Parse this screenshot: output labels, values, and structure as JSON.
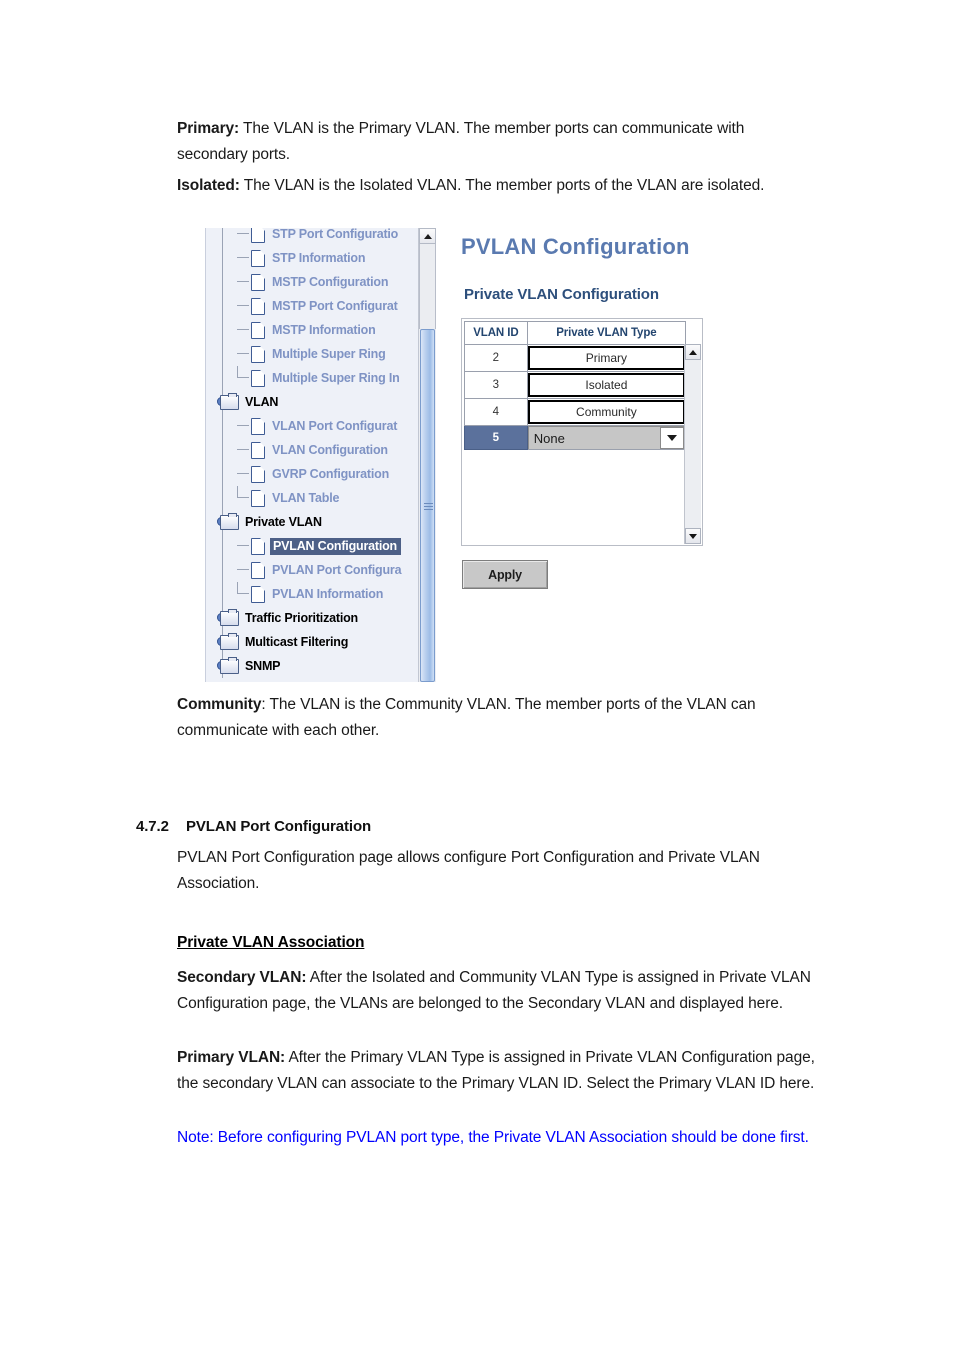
{
  "document": {
    "paragraphs": {
      "primary_label": "Primary:",
      "primary_text": " The VLAN is the Primary VLAN. The member ports can communicate with secondary ports.",
      "isolated_label": "Isolated:",
      "isolated_text": " The VLAN is the Isolated VLAN. The member ports of the VLAN are isolated.",
      "community_label": "Community",
      "community_text": ": The VLAN is the Community VLAN. The member ports of the VLAN can communicate with each other.",
      "section_number": "4.7.2",
      "section_title": "PVLAN Port Configuration",
      "section_body": "PVLAN Port Configuration page allows configure Port Configuration and Private VLAN Association.",
      "subsection_heading": "Private VLAN Association",
      "secondary_label": "Secondary VLAN:",
      "secondary_text": " After the Isolated and Community VLAN Type is assigned in Private VLAN Configuration page, the VLANs are belonged to the Secondary VLAN and displayed here.",
      "primaryvlan_label": "Primary VLAN:",
      "primaryvlan_text": " After the Primary VLAN Type is assigned in Private VLAN Configuration page, the secondary VLAN can associate to the Primary VLAN ID. Select the Primary VLAN ID here.",
      "note_text": "Note: Before configuring PVLAN port type, the Private VLAN Association should be done first."
    },
    "colors": {
      "note_blue": "#0000ff",
      "body_black": "#1a1a1a"
    }
  },
  "screenshot": {
    "title": "PVLAN Configuration",
    "subtitle": "Private VLAN Configuration",
    "title_color": "#5a7ab0",
    "subtitle_color": "#2d4f7c",
    "tree": {
      "items": [
        {
          "label": "STP Port Configuratio",
          "type": "leaf",
          "level": 2,
          "selected": false,
          "last": false
        },
        {
          "label": "STP Information",
          "type": "leaf",
          "level": 2,
          "selected": false,
          "last": false
        },
        {
          "label": "MSTP Configuration",
          "type": "leaf",
          "level": 2,
          "selected": false,
          "last": false
        },
        {
          "label": "MSTP Port Configurat",
          "type": "leaf",
          "level": 2,
          "selected": false,
          "last": false
        },
        {
          "label": "MSTP Information",
          "type": "leaf",
          "level": 2,
          "selected": false,
          "last": false
        },
        {
          "label": "Multiple Super Ring",
          "type": "leaf",
          "level": 2,
          "selected": false,
          "last": false
        },
        {
          "label": "Multiple Super Ring In",
          "type": "leaf",
          "level": 2,
          "selected": false,
          "last": true
        },
        {
          "label": "VLAN",
          "type": "folder",
          "level": 1,
          "selected": false,
          "last": false
        },
        {
          "label": "VLAN Port Configurat",
          "type": "leaf",
          "level": 2,
          "selected": false,
          "last": false
        },
        {
          "label": "VLAN Configuration",
          "type": "leaf",
          "level": 2,
          "selected": false,
          "last": false
        },
        {
          "label": "GVRP Configuration",
          "type": "leaf",
          "level": 2,
          "selected": false,
          "last": false
        },
        {
          "label": "VLAN Table",
          "type": "leaf",
          "level": 2,
          "selected": false,
          "last": true
        },
        {
          "label": "Private VLAN",
          "type": "folder",
          "level": 1,
          "selected": false,
          "last": false
        },
        {
          "label": "PVLAN Configuration",
          "type": "leaf",
          "level": 2,
          "selected": true,
          "last": false
        },
        {
          "label": "PVLAN Port Configura",
          "type": "leaf",
          "level": 2,
          "selected": false,
          "last": false
        },
        {
          "label": "PVLAN Information",
          "type": "leaf",
          "level": 2,
          "selected": false,
          "last": true
        },
        {
          "label": "Traffic Prioritization",
          "type": "folder",
          "level": 1,
          "selected": false,
          "last": false
        },
        {
          "label": "Multicast Filtering",
          "type": "folder",
          "level": 1,
          "selected": false,
          "last": false
        },
        {
          "label": "SNMP",
          "type": "folder",
          "level": 1,
          "selected": false,
          "last": false
        }
      ],
      "selected_bg": "#4d6087",
      "leaf_color": "#7f93c4"
    },
    "table": {
      "headers": [
        "VLAN ID",
        "Private VLAN Type"
      ],
      "rows": [
        {
          "vlan_id": "2",
          "vlan_type": "Primary",
          "active": false
        },
        {
          "vlan_id": "3",
          "vlan_type": "Isolated",
          "active": false
        },
        {
          "vlan_id": "4",
          "vlan_type": "Community",
          "active": false
        },
        {
          "vlan_id": "5",
          "vlan_type": "None",
          "active": true
        }
      ],
      "header_color": "#23456f",
      "active_row_bg": "#5b719c"
    },
    "apply_label": "Apply"
  }
}
